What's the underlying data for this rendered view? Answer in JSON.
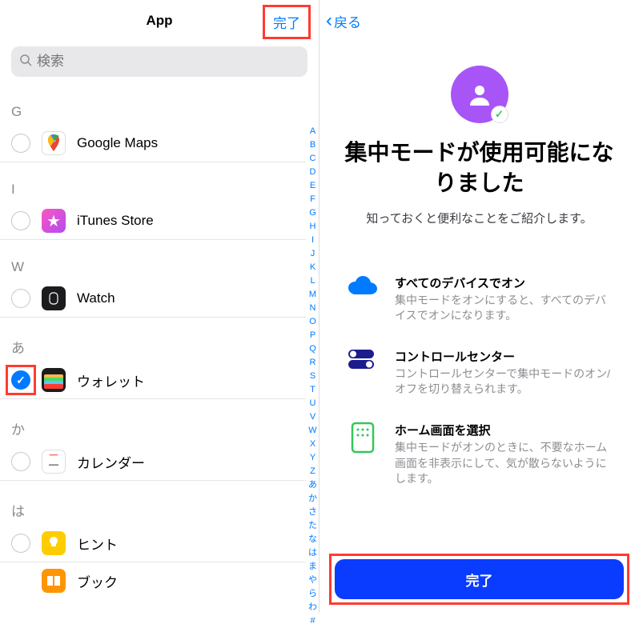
{
  "left": {
    "title": "App",
    "done": "完了",
    "search_placeholder": "検索",
    "sections": {
      "g": "G",
      "i": "I",
      "w": "W",
      "a": "あ",
      "ka": "か",
      "ha": "は"
    },
    "apps": {
      "gmaps": "Google Maps",
      "itunes": "iTunes Store",
      "watch": "Watch",
      "wallet": "ウォレット",
      "calendar": "カレンダー",
      "tips": "ヒント",
      "books": "ブック"
    },
    "index": [
      "A",
      "B",
      "C",
      "D",
      "E",
      "F",
      "G",
      "H",
      "I",
      "J",
      "K",
      "L",
      "M",
      "N",
      "O",
      "P",
      "Q",
      "R",
      "S",
      "T",
      "U",
      "V",
      "W",
      "X",
      "Y",
      "Z",
      "あ",
      "か",
      "さ",
      "た",
      "な",
      "は",
      "ま",
      "や",
      "ら",
      "わ",
      "#"
    ]
  },
  "right": {
    "back": "戻る",
    "title": "集中モードが使用可能になりました",
    "subtitle": "知っておくと便利なことをご紹介します。",
    "features": {
      "f1_title": "すべてのデバイスでオン",
      "f1_desc": "集中モードをオンにすると、すべてのデバイスでオンになります。",
      "f2_title": "コントロールセンター",
      "f2_desc": "コントロールセンターで集中モードのオン/オフを切り替えられます。",
      "f3_title": "ホーム画面を選択",
      "f3_desc": "集中モードがオンのときに、不要なホーム画面を非表示にして、気が散らないようにします。"
    },
    "primary": "完了"
  }
}
